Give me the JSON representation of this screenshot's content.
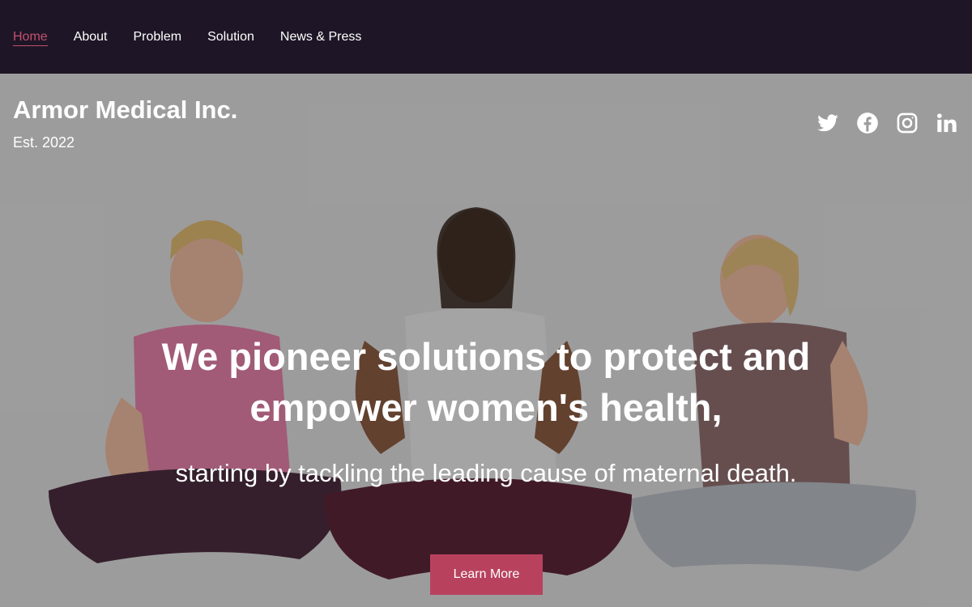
{
  "nav": {
    "items": [
      {
        "label": "Home",
        "active": true
      },
      {
        "label": "About",
        "active": false
      },
      {
        "label": "Problem",
        "active": false
      },
      {
        "label": "Solution",
        "active": false
      },
      {
        "label": "News & Press",
        "active": false
      }
    ]
  },
  "brand": {
    "title": "Armor Medical Inc.",
    "subtitle": "Est. 2022"
  },
  "social": [
    "twitter-icon",
    "facebook-icon",
    "instagram-icon",
    "linkedin-icon"
  ],
  "hero": {
    "headline_line1": "We pioneer solutions to protect and",
    "headline_line2": "empower women's health,",
    "subheadline": "starting by tackling the leading cause of maternal death.",
    "cta_label": "Learn More"
  },
  "colors": {
    "nav_background": "#1e1626",
    "accent": "#c4506f",
    "button": "#b8425e",
    "text": "#ffffff"
  }
}
